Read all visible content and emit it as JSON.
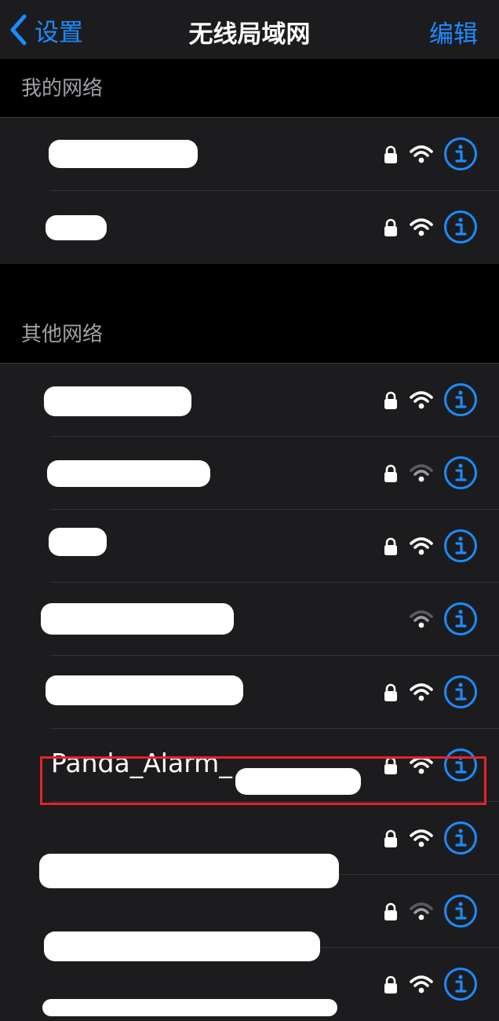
{
  "nav": {
    "back_label": "设置",
    "title": "无线局域网",
    "edit_label": "编辑"
  },
  "sections": [
    {
      "header": "我的网络",
      "networks": [
        {
          "ssid": "",
          "locked": true,
          "signal": "full"
        },
        {
          "ssid": "",
          "locked": true,
          "signal": "full"
        }
      ]
    },
    {
      "header": "其他网络",
      "networks": [
        {
          "ssid": "",
          "locked": true,
          "signal": "full"
        },
        {
          "ssid": "",
          "locked": true,
          "signal": "weak"
        },
        {
          "ssid": "",
          "locked": true,
          "signal": "full"
        },
        {
          "ssid": "",
          "locked": false,
          "signal": "weak"
        },
        {
          "ssid": "",
          "locked": true,
          "signal": "full"
        },
        {
          "ssid": "Panda_Alarm_",
          "locked": true,
          "signal": "full",
          "highlighted": true
        },
        {
          "ssid": "",
          "locked": true,
          "signal": "full"
        },
        {
          "ssid": "",
          "locked": true,
          "signal": "weak"
        },
        {
          "ssid": "",
          "locked": true,
          "signal": "full"
        }
      ]
    }
  ],
  "colors": {
    "accent": "#1a8cff",
    "highlight_border": "#e5232b",
    "background": "#000000",
    "cell": "#1c1c1e"
  },
  "icons": {
    "back": "chevron-left-icon",
    "lock": "lock-icon",
    "wifi": "wifi-icon",
    "info": "info-circle-icon"
  }
}
